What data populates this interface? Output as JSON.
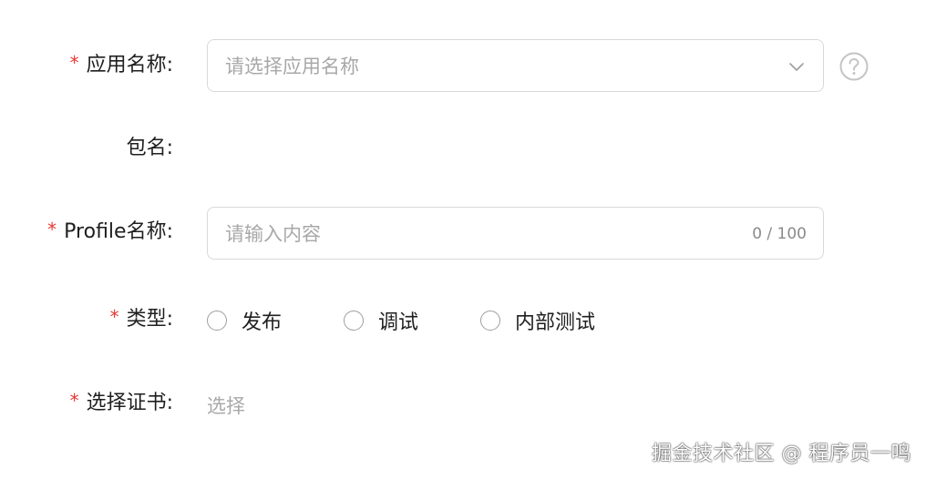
{
  "form": {
    "app_name": {
      "required_mark": "*",
      "label": "应用名称:",
      "placeholder": "请选择应用名称",
      "chevron_icon": "chevron-down-icon",
      "help_icon": "question-circle-icon"
    },
    "package_name": {
      "label": "包名:"
    },
    "profile_name": {
      "required_mark": "*",
      "label": "Profile名称:",
      "placeholder": "请输入内容",
      "counter": "0 / 100"
    },
    "type": {
      "required_mark": "*",
      "label": "类型:",
      "options": [
        "发布",
        "调试",
        "内部测试"
      ]
    },
    "certificate": {
      "required_mark": "*",
      "label": "选择证书:",
      "action_text": "选择"
    }
  },
  "watermark": "掘金技术社区 @ 程序员一鸣",
  "colors": {
    "required": "#e53935",
    "placeholder": "#a8a8a8",
    "border": "#d9d9d9"
  }
}
